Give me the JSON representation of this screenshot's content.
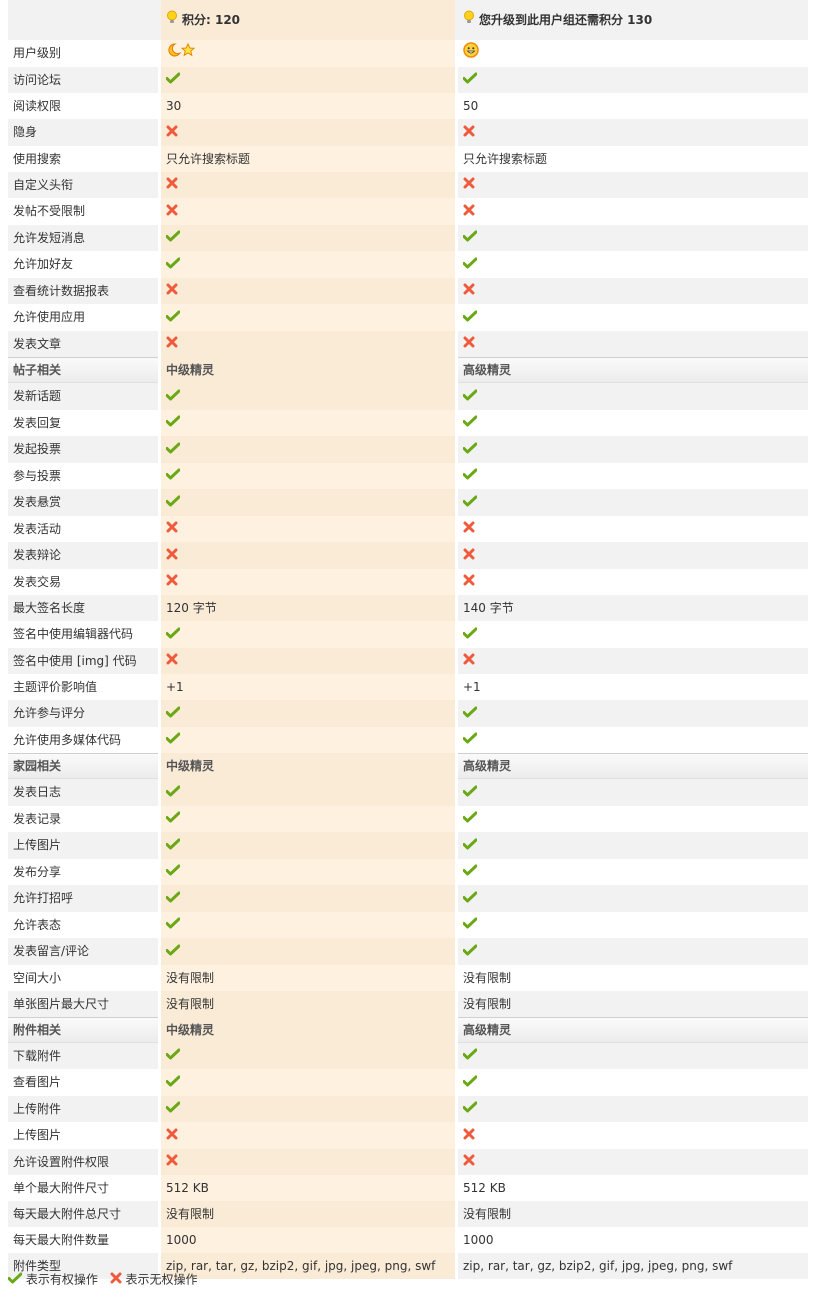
{
  "header": {
    "current_points": "积分: 120",
    "next_group_points": "您升级到此用户组还需积分 130"
  },
  "icons": {
    "yes": "check-icon",
    "no": "cross-icon",
    "bulb": "lightbulb-icon"
  },
  "colors": {
    "check_green": "#6aa815",
    "cross_red": "#f05a3c",
    "current_col_bg": "#faebd7",
    "row_gray": "#f2f2f2"
  },
  "general_rows": [
    {
      "label": "用户级别",
      "current": "icon:moon-star",
      "next": "icon:sun-smile"
    },
    {
      "label": "访问论坛",
      "current": "yes",
      "next": "yes"
    },
    {
      "label": "阅读权限",
      "current": "30",
      "next": "50"
    },
    {
      "label": "隐身",
      "current": "no",
      "next": "no"
    },
    {
      "label": "使用搜索",
      "current": "只允许搜索标题",
      "next": "只允许搜索标题"
    },
    {
      "label": "自定义头衔",
      "current": "no",
      "next": "no"
    },
    {
      "label": "发帖不受限制",
      "current": "no",
      "next": "no"
    },
    {
      "label": "允许发短消息",
      "current": "yes",
      "next": "yes"
    },
    {
      "label": "允许加好友",
      "current": "yes",
      "next": "yes"
    },
    {
      "label": "查看统计数据报表",
      "current": "no",
      "next": "no"
    },
    {
      "label": "允许使用应用",
      "current": "yes",
      "next": "yes"
    },
    {
      "label": "发表文章",
      "current": "no",
      "next": "no"
    }
  ],
  "sections": [
    {
      "title": "帖子相关",
      "current_group": "中级精灵",
      "next_group": "高级精灵",
      "rows": [
        {
          "label": "发新话题",
          "current": "yes",
          "next": "yes"
        },
        {
          "label": "发表回复",
          "current": "yes",
          "next": "yes"
        },
        {
          "label": "发起投票",
          "current": "yes",
          "next": "yes"
        },
        {
          "label": "参与投票",
          "current": "yes",
          "next": "yes"
        },
        {
          "label": "发表悬赏",
          "current": "yes",
          "next": "yes"
        },
        {
          "label": "发表活动",
          "current": "no",
          "next": "no"
        },
        {
          "label": "发表辩论",
          "current": "no",
          "next": "no"
        },
        {
          "label": "发表交易",
          "current": "no",
          "next": "no"
        },
        {
          "label": "最大签名长度",
          "current": "120 字节",
          "next": "140 字节"
        },
        {
          "label": "签名中使用编辑器代码",
          "current": "yes",
          "next": "yes"
        },
        {
          "label": "签名中使用 [img] 代码",
          "current": "no",
          "next": "no"
        },
        {
          "label": "主题评价影响值",
          "current": "+1",
          "next": "+1"
        },
        {
          "label": "允许参与评分",
          "current": "yes",
          "next": "yes"
        },
        {
          "label": "允许使用多媒体代码",
          "current": "yes",
          "next": "yes"
        }
      ]
    },
    {
      "title": "家园相关",
      "current_group": "中级精灵",
      "next_group": "高级精灵",
      "rows": [
        {
          "label": "发表日志",
          "current": "yes",
          "next": "yes"
        },
        {
          "label": "发表记录",
          "current": "yes",
          "next": "yes"
        },
        {
          "label": "上传图片",
          "current": "yes",
          "next": "yes"
        },
        {
          "label": "发布分享",
          "current": "yes",
          "next": "yes"
        },
        {
          "label": "允许打招呼",
          "current": "yes",
          "next": "yes"
        },
        {
          "label": "允许表态",
          "current": "yes",
          "next": "yes"
        },
        {
          "label": "发表留言/评论",
          "current": "yes",
          "next": "yes"
        },
        {
          "label": "空间大小",
          "current": "没有限制",
          "next": "没有限制"
        },
        {
          "label": "单张图片最大尺寸",
          "current": "没有限制",
          "next": "没有限制"
        }
      ]
    },
    {
      "title": "附件相关",
      "current_group": "中级精灵",
      "next_group": "高级精灵",
      "rows": [
        {
          "label": "下载附件",
          "current": "yes",
          "next": "yes"
        },
        {
          "label": "查看图片",
          "current": "yes",
          "next": "yes"
        },
        {
          "label": "上传附件",
          "current": "yes",
          "next": "yes"
        },
        {
          "label": "上传图片",
          "current": "no",
          "next": "no"
        },
        {
          "label": "允许设置附件权限",
          "current": "no",
          "next": "no"
        },
        {
          "label": "单个最大附件尺寸",
          "current": "512 KB",
          "next": "512 KB"
        },
        {
          "label": "每天最大附件总尺寸",
          "current": "没有限制",
          "next": "没有限制"
        },
        {
          "label": "每天最大附件数量",
          "current": "1000",
          "next": "1000"
        },
        {
          "label": "附件类型",
          "current": "zip, rar, tar, gz, bzip2, gif, jpg, jpeg, png, swf",
          "next": "zip, rar, tar, gz, bzip2, gif, jpg, jpeg, png, swf"
        }
      ]
    }
  ],
  "legend": {
    "yes_label": "表示有权操作",
    "no_label": "表示无权操作"
  }
}
